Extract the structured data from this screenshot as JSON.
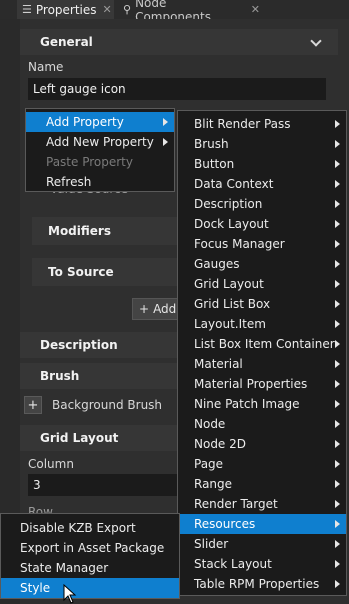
{
  "tabs": [
    {
      "label": "Properties",
      "icon": "list-icon"
    },
    {
      "label": "Node Components",
      "icon": "node-components-icon"
    }
  ],
  "general": {
    "header": "General",
    "name_label": "Name",
    "name_value": "Left gauge icon"
  },
  "background_text": {
    "value_source": "Value Source",
    "modifiers": "Modifiers",
    "to_source": "To Source",
    "add_button": "Add",
    "description": "Description",
    "brush": "Brush",
    "background_brush": "Background Brush",
    "grid_layout": "Grid Layout",
    "column_label": "Column",
    "column_value": "3",
    "row_label": "Row"
  },
  "context_menu": {
    "items": [
      {
        "label": "Add Property",
        "submenu": true,
        "highlighted": true
      },
      {
        "label": "Add New Property",
        "submenu": true
      },
      {
        "label": "Paste Property",
        "disabled": true
      },
      {
        "label": "Refresh"
      }
    ]
  },
  "property_submenu": {
    "items": [
      {
        "label": "Blit Render Pass"
      },
      {
        "label": "Brush"
      },
      {
        "label": "Button"
      },
      {
        "label": "Data Context"
      },
      {
        "label": "Description"
      },
      {
        "label": "Dock Layout"
      },
      {
        "label": "Focus Manager"
      },
      {
        "label": "Gauges"
      },
      {
        "label": "Grid Layout"
      },
      {
        "label": "Grid List Box"
      },
      {
        "label": "Layout.Item"
      },
      {
        "label": "List Box Item Container"
      },
      {
        "label": "Material"
      },
      {
        "label": "Material Properties"
      },
      {
        "label": "Nine Patch Image"
      },
      {
        "label": "Node"
      },
      {
        "label": "Node 2D"
      },
      {
        "label": "Page"
      },
      {
        "label": "Range"
      },
      {
        "label": "Render Target"
      },
      {
        "label": "Resources",
        "highlighted": true
      },
      {
        "label": "Slider"
      },
      {
        "label": "Stack Layout"
      },
      {
        "label": "Table RPM Properties"
      }
    ]
  },
  "resources_submenu": {
    "items": [
      {
        "label": "Disable KZB Export"
      },
      {
        "label": "Export in Asset Package"
      },
      {
        "label": "State Manager"
      },
      {
        "label": "Style",
        "highlighted": true
      }
    ]
  },
  "colors": {
    "highlight": "#0f7fcf",
    "menu_bg": "#1b1b1b",
    "panel_bg": "#2f2f2f"
  }
}
